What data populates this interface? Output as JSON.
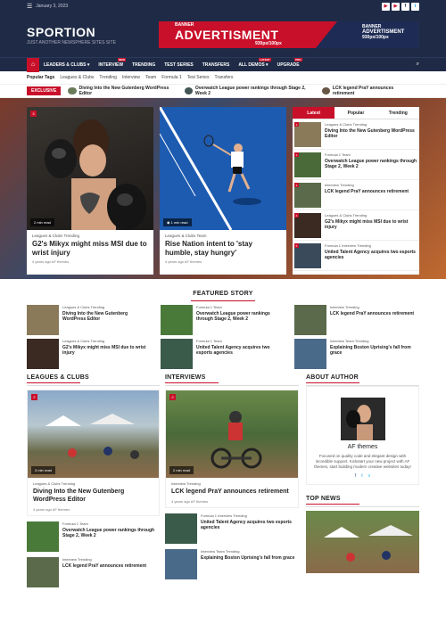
{
  "topbar": {
    "date": "January 3, 2023",
    "social": [
      "▶",
      "▶",
      "f",
      "t"
    ]
  },
  "header": {
    "site_title": "SPORTION",
    "tagline": "JUST ANOTHER NEWSPHERE SITES SITE",
    "banner_small": "BANNER",
    "banner_main": "ADVERTISMENT",
    "banner_size": "930px/100px",
    "banner_r1": "BANNER",
    "banner_r2": "ADVERTISMENT",
    "banner_r3": "930px/100px"
  },
  "nav": {
    "items": [
      {
        "label": "LEADERS & CLUBS ▾",
        "badge": ""
      },
      {
        "label": "INTERVIEW",
        "badge": "NEW"
      },
      {
        "label": "TRENDING",
        "badge": ""
      },
      {
        "label": "TEST SERIES",
        "badge": ""
      },
      {
        "label": "TRANSFERS",
        "badge": ""
      },
      {
        "label": "ALL DEMOS ▾",
        "badge": "LATEST"
      },
      {
        "label": "UPGRADE",
        "badge": "PRO"
      }
    ]
  },
  "popular_tags": {
    "label": "Popular Tags",
    "items": [
      "Leagues & Clubs",
      "Trending",
      "Interview",
      "Team",
      "Formula 1",
      "Test Series",
      "Transfers"
    ]
  },
  "ticker": {
    "label": "EXCLUSIVE",
    "items": [
      "Diving Into the New Gutenberg WordPress Editor",
      "Overwatch League power rankings through Stage 2, Week 2",
      "LCK legend PraY announces retirement"
    ]
  },
  "hero": {
    "cards": [
      {
        "num": "3",
        "read": "2 min read",
        "meta": "Leagues & Clubs   Trending",
        "title": "G2's Mikyx might miss MSI due to wrist injury",
        "byline": "4 years ago  AF themes"
      },
      {
        "num": "",
        "read": "1 min read",
        "meta": "Leagues & Clubs   Team",
        "title": "Rise Nation intent to 'stay humble, stay hungry'",
        "byline": "4 years ago  AF themes"
      }
    ]
  },
  "tabs": {
    "labels": [
      "Latest",
      "Popular",
      "Trending"
    ],
    "items": [
      {
        "num": "1",
        "cat": "Leagues & Clubs   Trending",
        "title": "Diving Into the New Gutenberg WordPress Editor"
      },
      {
        "num": "2",
        "cat": "Formula 1   Team",
        "title": "Overwatch League power rankings through Stage 2, Week 2"
      },
      {
        "num": "3",
        "cat": "Interview   Trending",
        "title": "LCK legend PraY announces retirement"
      },
      {
        "num": "4",
        "cat": "Leagues & Clubs   Trending",
        "title": "G2's Mikyx might miss MSI due to wrist injury"
      },
      {
        "num": "5",
        "cat": "Formula 1   Interview   Trending",
        "title": "United Talent Agency acquires two esports agencies"
      }
    ]
  },
  "featured": {
    "title": "FEATURED STORY",
    "items": [
      {
        "cat": "Leagues & Clubs   Trending",
        "title": "Diving Into the New Gutenberg WordPress Editor"
      },
      {
        "cat": "Formula 1   Team",
        "title": "Overwatch League power rankings through Stage 2, Week 2"
      },
      {
        "cat": "Interview   Trending",
        "title": "LCK legend PraY announces retirement"
      },
      {
        "cat": "Leagues & Clubs   Trending",
        "title": "G2's Mikyx might miss MSI due to wrist injury"
      },
      {
        "cat": "Formula 1   Team",
        "title": "United Talent Agency acquires two esports agencies"
      },
      {
        "cat": "Interview   Team   Trending",
        "title": "Explaining Boston Uprising's fall from grace"
      }
    ]
  },
  "leagues": {
    "heading": "LEAGUES & CLUBS",
    "num": "2",
    "read": "3 min read",
    "cat": "Leagues & Clubs   Trending",
    "title": "Diving Into the New Gutenberg WordPress Editor",
    "byline": "4 years ago  AF themes",
    "small": [
      {
        "cat": "Formula 1   Team",
        "title": "Overwatch League power rankings through Stage 2, Week 2"
      },
      {
        "cat": "Interview   Trending",
        "title": "LCK legend PraY announces retirement"
      }
    ]
  },
  "interviews": {
    "heading": "INTERVIEWS",
    "num": "2",
    "read": "2 min read",
    "cat": "Interview   Trending",
    "title": "LCK legend PraY announces retirement",
    "byline": "4 years ago  AF themes",
    "small": [
      {
        "cat": "Formula 1   Interview   Trending",
        "title": "United Talent Agency acquires two esports agencies"
      },
      {
        "cat": "Interview   Team   Trending",
        "title": "Explaining Boston Uprising's fall from grace"
      }
    ]
  },
  "author": {
    "heading": "ABOUT AUTHOR",
    "name": "AF themes",
    "bio": "Focused on quality code and elegant design with incredible support. Kickstart your new project with AF themes, start building modern creative websites today!",
    "social": [
      "f",
      "t",
      "v"
    ]
  },
  "topnews": {
    "heading": "TOP NEWS"
  }
}
